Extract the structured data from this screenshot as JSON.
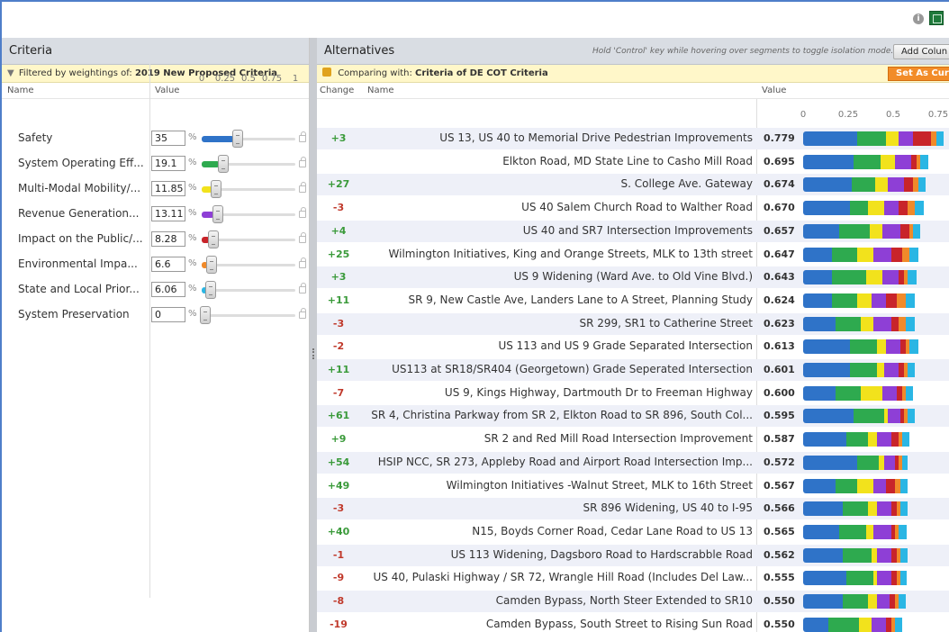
{
  "left": {
    "title": "Criteria",
    "filter_label": "Filtered by weightings of:",
    "filter_value": "2019 New Proposed Criteria",
    "col_name": "Name",
    "col_value": "Value",
    "scale": [
      "0",
      "0.25",
      "0.5",
      "0.75",
      "1"
    ],
    "pct_symbol": "%",
    "criteria": [
      {
        "name": "Safety",
        "value": "35",
        "weight": 0.35,
        "color": "#2f73c8"
      },
      {
        "name": "System Operating Eff...",
        "value": "19.1",
        "weight": 0.191,
        "color": "#2eaa4f"
      },
      {
        "name": "Multi-Modal Mobility/...",
        "value": "11.85",
        "weight": 0.1185,
        "color": "#f2e21c"
      },
      {
        "name": "Revenue Generation...",
        "value": "13.11",
        "weight": 0.1311,
        "color": "#8e3fd6"
      },
      {
        "name": "Impact on the Public/...",
        "value": "8.28",
        "weight": 0.0828,
        "color": "#c8242a"
      },
      {
        "name": "Environmental Impa...",
        "value": "6.6",
        "weight": 0.066,
        "color": "#f08a2a"
      },
      {
        "name": "State and Local Prior...",
        "value": "6.06",
        "weight": 0.0606,
        "color": "#2ab6e4"
      },
      {
        "name": "System Preservation",
        "value": "0",
        "weight": 0,
        "color": "#999999"
      }
    ]
  },
  "right": {
    "title": "Alternatives",
    "hint": "Hold 'Control' key while hovering over segments to toggle isolation mode.",
    "add_column": "Add Colun",
    "compare_label": "Comparing with:",
    "compare_value": "Criteria of DE COT Criteria",
    "set_button": "Set As Curre",
    "col_change": "Change",
    "col_name": "Name",
    "col_value": "Value",
    "scale": [
      "0",
      "0.25",
      "0.5",
      "0.75"
    ],
    "alternatives": [
      {
        "change": "+3",
        "name": "US 13, US 40 to Memorial Drive Pedestrian Improvements",
        "value": "0.779",
        "segs": [
          0.3,
          0.16,
          0.07,
          0.08,
          0.1,
          0.03,
          0.04
        ]
      },
      {
        "change": "",
        "name": "Elkton Road, MD State Line to Casho Mill Road",
        "value": "0.695",
        "segs": [
          0.28,
          0.15,
          0.08,
          0.09,
          0.03,
          0.02,
          0.045
        ]
      },
      {
        "change": "+27",
        "name": "S. College Ave. Gateway",
        "value": "0.674",
        "segs": [
          0.27,
          0.13,
          0.07,
          0.09,
          0.05,
          0.03,
          0.04
        ]
      },
      {
        "change": "-3",
        "name": "US 40 Salem Church Road to Walther Road",
        "value": "0.670",
        "segs": [
          0.26,
          0.1,
          0.09,
          0.08,
          0.05,
          0.04,
          0.05
        ]
      },
      {
        "change": "+4",
        "name": "US 40 and SR7 Intersection Improvements",
        "value": "0.657",
        "segs": [
          0.2,
          0.17,
          0.07,
          0.1,
          0.05,
          0.02,
          0.04
        ]
      },
      {
        "change": "+25",
        "name": "Wilmington Initiatives, King and Orange Streets, MLK to 13th street",
        "value": "0.647",
        "segs": [
          0.16,
          0.14,
          0.09,
          0.1,
          0.06,
          0.04,
          0.05
        ]
      },
      {
        "change": "+3",
        "name": "US 9 Widening (Ward Ave. to Old Vine Blvd.)",
        "value": "0.643",
        "segs": [
          0.16,
          0.19,
          0.09,
          0.09,
          0.03,
          0.02,
          0.05
        ]
      },
      {
        "change": "+11",
        "name": "SR 9, New Castle Ave, Landers Lane to A Street, Planning Study",
        "value": "0.624",
        "segs": [
          0.16,
          0.14,
          0.08,
          0.08,
          0.06,
          0.05,
          0.05
        ]
      },
      {
        "change": "-3",
        "name": "SR 299, SR1 to Catherine Street",
        "value": "0.623",
        "segs": [
          0.18,
          0.14,
          0.07,
          0.1,
          0.04,
          0.04,
          0.05
        ]
      },
      {
        "change": "-2",
        "name": "US 113 and US 9 Grade Separated Intersection",
        "value": "0.613",
        "segs": [
          0.26,
          0.15,
          0.05,
          0.08,
          0.03,
          0.02,
          0.05
        ]
      },
      {
        "change": "+11",
        "name": "US113 at SR18/SR404 (Georgetown) Grade Seperated Intersection",
        "value": "0.601",
        "segs": [
          0.26,
          0.15,
          0.04,
          0.08,
          0.03,
          0.02,
          0.04
        ]
      },
      {
        "change": "-7",
        "name": "US 9, Kings Highway, Dartmouth Dr to Freeman Highway",
        "value": "0.600",
        "segs": [
          0.18,
          0.14,
          0.12,
          0.08,
          0.03,
          0.02,
          0.04
        ]
      },
      {
        "change": "+61",
        "name": "SR 4, Christina Parkway from SR 2, Elkton Road to SR 896, South Col...",
        "value": "0.595",
        "segs": [
          0.28,
          0.17,
          0.02,
          0.07,
          0.02,
          0.02,
          0.04
        ]
      },
      {
        "change": "+9",
        "name": "SR 2 and Red Mill Road Intersection Improvement",
        "value": "0.587",
        "segs": [
          0.24,
          0.12,
          0.05,
          0.08,
          0.04,
          0.02,
          0.04
        ]
      },
      {
        "change": "+54",
        "name": "HSIP NCC, SR 273, Appleby Road and Airport Road Intersection Imp...",
        "value": "0.572",
        "segs": [
          0.3,
          0.12,
          0.03,
          0.06,
          0.02,
          0.02,
          0.03
        ]
      },
      {
        "change": "+49",
        "name": "Wilmington Initiatives -Walnut Street, MLK to 16th Street",
        "value": "0.567",
        "segs": [
          0.18,
          0.12,
          0.09,
          0.07,
          0.05,
          0.03,
          0.04
        ]
      },
      {
        "change": "-3",
        "name": "SR 896 Widening, US 40 to I-95",
        "value": "0.566",
        "segs": [
          0.22,
          0.14,
          0.05,
          0.08,
          0.03,
          0.02,
          0.04
        ]
      },
      {
        "change": "+40",
        "name": "N15, Boyds Corner Road, Cedar Lane Road to US 13",
        "value": "0.565",
        "segs": [
          0.2,
          0.15,
          0.04,
          0.1,
          0.02,
          0.02,
          0.045
        ]
      },
      {
        "change": "-1",
        "name": "US 113 Widening, Dagsboro Road to Hardscrabble Road",
        "value": "0.562",
        "segs": [
          0.22,
          0.16,
          0.03,
          0.08,
          0.03,
          0.02,
          0.04
        ]
      },
      {
        "change": "-9",
        "name": "US 40, Pulaski Highway / SR 72, Wrangle Hill Road (Includes Del Law...",
        "value": "0.555",
        "segs": [
          0.24,
          0.15,
          0.02,
          0.08,
          0.03,
          0.02,
          0.035
        ]
      },
      {
        "change": "-8",
        "name": "Camden Bypass, North Steer Extended to SR10",
        "value": "0.550",
        "segs": [
          0.22,
          0.14,
          0.05,
          0.07,
          0.03,
          0.02,
          0.04
        ]
      },
      {
        "change": "-19",
        "name": "Camden Bypass, South Street to Rising Sun Road",
        "value": "0.550",
        "segs": [
          0.14,
          0.17,
          0.07,
          0.08,
          0.03,
          0.02,
          0.04
        ]
      }
    ]
  }
}
